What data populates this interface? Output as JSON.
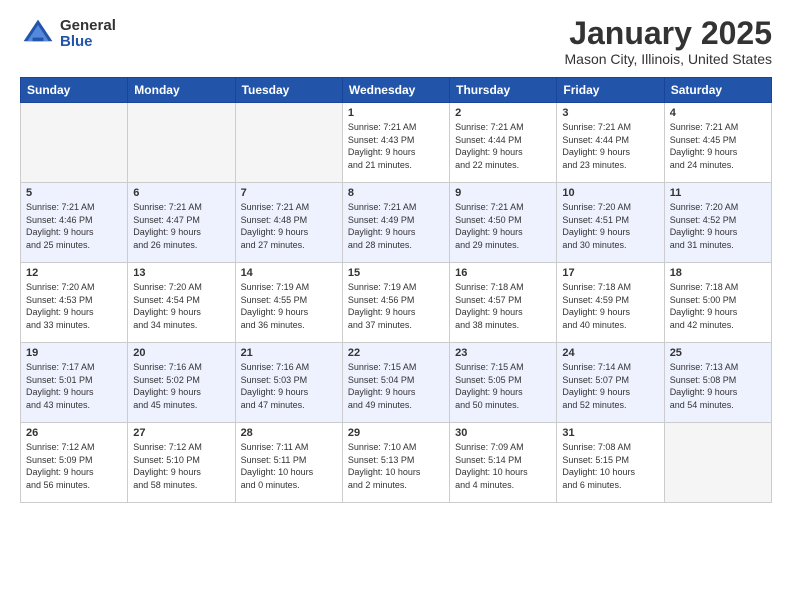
{
  "logo": {
    "general": "General",
    "blue": "Blue"
  },
  "header": {
    "title": "January 2025",
    "subtitle": "Mason City, Illinois, United States"
  },
  "weekdays": [
    "Sunday",
    "Monday",
    "Tuesday",
    "Wednesday",
    "Thursday",
    "Friday",
    "Saturday"
  ],
  "weeks": [
    [
      {
        "day": "",
        "info": ""
      },
      {
        "day": "",
        "info": ""
      },
      {
        "day": "",
        "info": ""
      },
      {
        "day": "1",
        "info": "Sunrise: 7:21 AM\nSunset: 4:43 PM\nDaylight: 9 hours\nand 21 minutes."
      },
      {
        "day": "2",
        "info": "Sunrise: 7:21 AM\nSunset: 4:44 PM\nDaylight: 9 hours\nand 22 minutes."
      },
      {
        "day": "3",
        "info": "Sunrise: 7:21 AM\nSunset: 4:44 PM\nDaylight: 9 hours\nand 23 minutes."
      },
      {
        "day": "4",
        "info": "Sunrise: 7:21 AM\nSunset: 4:45 PM\nDaylight: 9 hours\nand 24 minutes."
      }
    ],
    [
      {
        "day": "5",
        "info": "Sunrise: 7:21 AM\nSunset: 4:46 PM\nDaylight: 9 hours\nand 25 minutes."
      },
      {
        "day": "6",
        "info": "Sunrise: 7:21 AM\nSunset: 4:47 PM\nDaylight: 9 hours\nand 26 minutes."
      },
      {
        "day": "7",
        "info": "Sunrise: 7:21 AM\nSunset: 4:48 PM\nDaylight: 9 hours\nand 27 minutes."
      },
      {
        "day": "8",
        "info": "Sunrise: 7:21 AM\nSunset: 4:49 PM\nDaylight: 9 hours\nand 28 minutes."
      },
      {
        "day": "9",
        "info": "Sunrise: 7:21 AM\nSunset: 4:50 PM\nDaylight: 9 hours\nand 29 minutes."
      },
      {
        "day": "10",
        "info": "Sunrise: 7:20 AM\nSunset: 4:51 PM\nDaylight: 9 hours\nand 30 minutes."
      },
      {
        "day": "11",
        "info": "Sunrise: 7:20 AM\nSunset: 4:52 PM\nDaylight: 9 hours\nand 31 minutes."
      }
    ],
    [
      {
        "day": "12",
        "info": "Sunrise: 7:20 AM\nSunset: 4:53 PM\nDaylight: 9 hours\nand 33 minutes."
      },
      {
        "day": "13",
        "info": "Sunrise: 7:20 AM\nSunset: 4:54 PM\nDaylight: 9 hours\nand 34 minutes."
      },
      {
        "day": "14",
        "info": "Sunrise: 7:19 AM\nSunset: 4:55 PM\nDaylight: 9 hours\nand 36 minutes."
      },
      {
        "day": "15",
        "info": "Sunrise: 7:19 AM\nSunset: 4:56 PM\nDaylight: 9 hours\nand 37 minutes."
      },
      {
        "day": "16",
        "info": "Sunrise: 7:18 AM\nSunset: 4:57 PM\nDaylight: 9 hours\nand 38 minutes."
      },
      {
        "day": "17",
        "info": "Sunrise: 7:18 AM\nSunset: 4:59 PM\nDaylight: 9 hours\nand 40 minutes."
      },
      {
        "day": "18",
        "info": "Sunrise: 7:18 AM\nSunset: 5:00 PM\nDaylight: 9 hours\nand 42 minutes."
      }
    ],
    [
      {
        "day": "19",
        "info": "Sunrise: 7:17 AM\nSunset: 5:01 PM\nDaylight: 9 hours\nand 43 minutes."
      },
      {
        "day": "20",
        "info": "Sunrise: 7:16 AM\nSunset: 5:02 PM\nDaylight: 9 hours\nand 45 minutes."
      },
      {
        "day": "21",
        "info": "Sunrise: 7:16 AM\nSunset: 5:03 PM\nDaylight: 9 hours\nand 47 minutes."
      },
      {
        "day": "22",
        "info": "Sunrise: 7:15 AM\nSunset: 5:04 PM\nDaylight: 9 hours\nand 49 minutes."
      },
      {
        "day": "23",
        "info": "Sunrise: 7:15 AM\nSunset: 5:05 PM\nDaylight: 9 hours\nand 50 minutes."
      },
      {
        "day": "24",
        "info": "Sunrise: 7:14 AM\nSunset: 5:07 PM\nDaylight: 9 hours\nand 52 minutes."
      },
      {
        "day": "25",
        "info": "Sunrise: 7:13 AM\nSunset: 5:08 PM\nDaylight: 9 hours\nand 54 minutes."
      }
    ],
    [
      {
        "day": "26",
        "info": "Sunrise: 7:12 AM\nSunset: 5:09 PM\nDaylight: 9 hours\nand 56 minutes."
      },
      {
        "day": "27",
        "info": "Sunrise: 7:12 AM\nSunset: 5:10 PM\nDaylight: 9 hours\nand 58 minutes."
      },
      {
        "day": "28",
        "info": "Sunrise: 7:11 AM\nSunset: 5:11 PM\nDaylight: 10 hours\nand 0 minutes."
      },
      {
        "day": "29",
        "info": "Sunrise: 7:10 AM\nSunset: 5:13 PM\nDaylight: 10 hours\nand 2 minutes."
      },
      {
        "day": "30",
        "info": "Sunrise: 7:09 AM\nSunset: 5:14 PM\nDaylight: 10 hours\nand 4 minutes."
      },
      {
        "day": "31",
        "info": "Sunrise: 7:08 AM\nSunset: 5:15 PM\nDaylight: 10 hours\nand 6 minutes."
      },
      {
        "day": "",
        "info": ""
      }
    ]
  ]
}
